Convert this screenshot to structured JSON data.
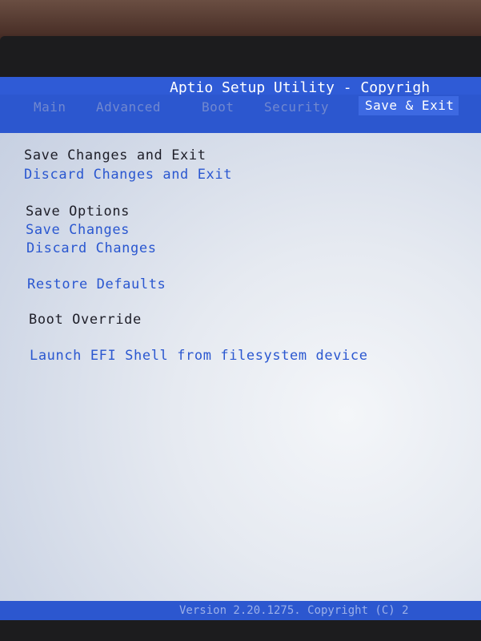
{
  "header": {
    "title": "Aptio Setup Utility - Copyrigh"
  },
  "tabs": [
    {
      "label": "Main",
      "active": false
    },
    {
      "label": "Advanced",
      "active": false
    },
    {
      "label": "Boot",
      "active": false
    },
    {
      "label": "Security",
      "active": false
    },
    {
      "label": "Save & Exit",
      "active": true
    }
  ],
  "menu": {
    "save_changes_and_exit": "Save Changes and Exit",
    "discard_changes_and_exit": "Discard Changes and Exit",
    "save_options_heading": "Save Options",
    "save_changes": "Save Changes",
    "discard_changes": "Discard Changes",
    "restore_defaults": "Restore Defaults",
    "boot_override_heading": "Boot Override",
    "launch_efi_shell": "Launch EFI Shell from filesystem device"
  },
  "footer": {
    "version_text": "Version 2.20.1275. Copyright (C) 2"
  },
  "colors": {
    "accent_blue": "#2c57cf",
    "option_text": "#2a57d0",
    "heading_text": "#1e1e28",
    "screen_bg": "#e6eaf1"
  }
}
